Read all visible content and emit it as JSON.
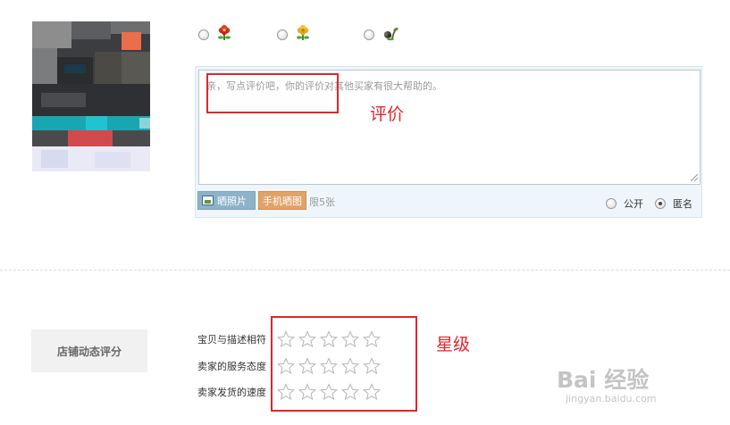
{
  "product": {
    "image": "pixelated product thumbnail"
  },
  "rating_options": [
    {
      "name": "good",
      "icon": "red-flower-icon",
      "color": "#d92a1c",
      "checked": false
    },
    {
      "name": "neutral",
      "icon": "yellow-flower-icon",
      "color": "#e8b21c",
      "checked": false
    },
    {
      "name": "bad",
      "icon": "wilted-flower-icon",
      "color": "#4a6b3a",
      "checked": false
    }
  ],
  "review": {
    "placeholder": "亲，写点评价吧，你的评价对其他买家有很大帮助的。",
    "photo_button": "晒照片",
    "mobile_button": "手机晒图",
    "limit": "限5张",
    "visibility": [
      {
        "label": "公开",
        "checked": false
      },
      {
        "label": "匿名",
        "checked": true
      }
    ]
  },
  "annotations": {
    "review_label": "评价",
    "stars_label": "星级",
    "color": "#e0262b"
  },
  "shop_rating": {
    "tag": "店铺动态评分",
    "rows": [
      {
        "label": "宝贝与描述相符",
        "stars": 5,
        "filled": 0
      },
      {
        "label": "卖家的服务态度",
        "stars": 5,
        "filled": 0
      },
      {
        "label": "卖家发货的速度",
        "stars": 5,
        "filled": 0
      }
    ]
  },
  "watermark": {
    "logo": "Bai 经验",
    "url": "jingyan.baidu.com"
  }
}
